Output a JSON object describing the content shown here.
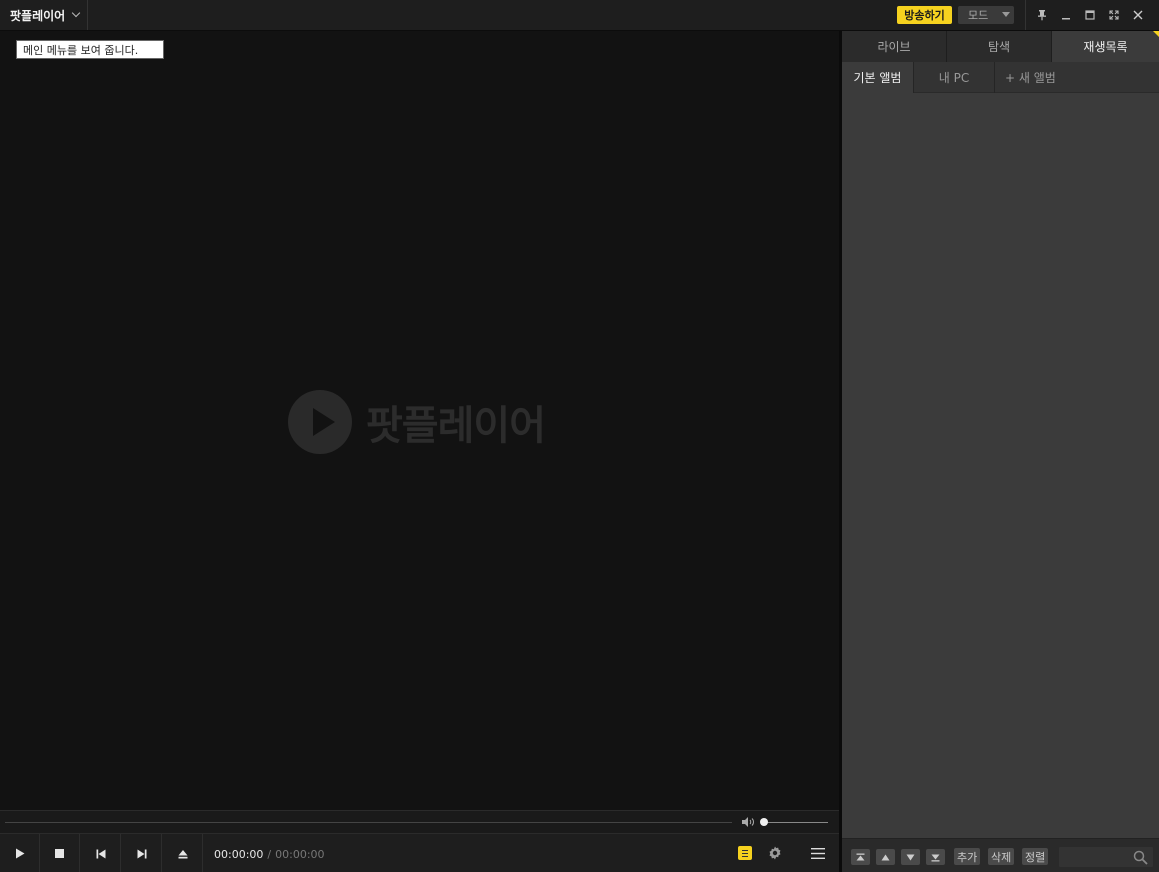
{
  "app": {
    "name": "팟플레이어"
  },
  "titlebar": {
    "broadcast_label": "방송하기",
    "mode_label": "모드",
    "accent": "#f6d21f"
  },
  "tooltip": {
    "text": "메인 메뉴를 보여 줍니다."
  },
  "video": {
    "logo_text": "팟플레이어"
  },
  "playback": {
    "current_time": "00:00:00",
    "separator": "/",
    "total_time": "00:00:00"
  },
  "panel": {
    "tabs": [
      {
        "label": "라이브"
      },
      {
        "label": "탐색"
      },
      {
        "label": "재생목록"
      }
    ],
    "subtabs": [
      {
        "label": "기본 앨범"
      },
      {
        "label": "내 PC"
      },
      {
        "label": "+ 새 앨범"
      }
    ],
    "bottom": {
      "add_label": "추가",
      "delete_label": "삭제",
      "sort_label": "정렬",
      "search_placeholder": ""
    }
  }
}
